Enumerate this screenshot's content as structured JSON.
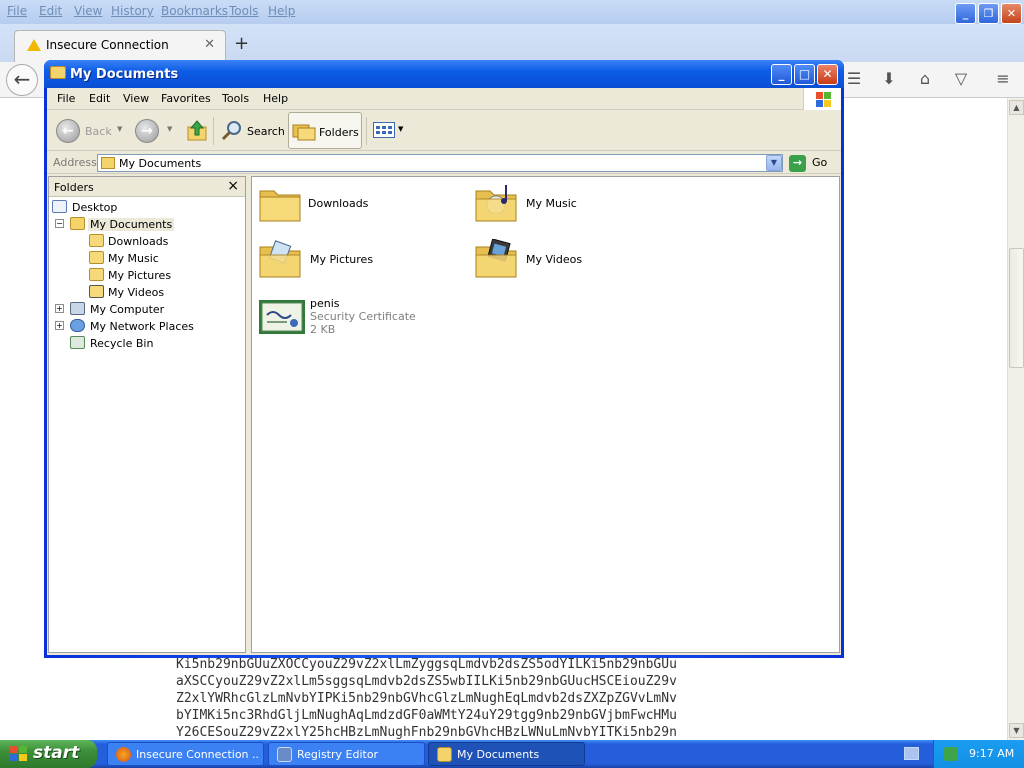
{
  "firefox": {
    "menu": [
      "File",
      "Edit",
      "View",
      "History",
      "Bookmarks",
      "Tools",
      "Help"
    ],
    "tab_title": "Insecure Connection",
    "new_tab": "+",
    "page_text_lines": [
      "Ki5nb29nbGUuZXOCCyouZ29vZ2xlLmZyggsqLmdvb2dsZS5odYILKi5nb29nbGUu",
      "aXSCCyouZ29vZ2xlLm5sggsqLmdvb2dsZS5wbIILKi5nb29nbGUucHSCEiouZ29v",
      "Z2xlYWRhcGlzLmNvbYIPKi5nb29nbGVhcGlzLmNughEqLmdvb2dsZXZpZGVvLmNv",
      "bYIMKi5nc3RhdGljLmNughAqLmdzdGF0aWMtY24uY29tgg9nb29nbGVjbmFwcHMu",
      "Y26CESouZ29vZ2xlY25hcHBzLmNughFnb29nbGVhcHBzLWNuLmNvbYITKi5nb29n"
    ]
  },
  "explorer": {
    "title": "My Documents",
    "menu": [
      "File",
      "Edit",
      "View",
      "Favorites",
      "Tools",
      "Help"
    ],
    "toolbar": {
      "back": "Back",
      "search": "Search",
      "folders": "Folders"
    },
    "address": {
      "label": "Address",
      "value": "My Documents",
      "go": "Go"
    },
    "tree": {
      "header": "Folders",
      "close": "×",
      "nodes": [
        {
          "label": "Desktop"
        },
        {
          "label": "My Documents",
          "expander": "−"
        },
        {
          "label": "Downloads"
        },
        {
          "label": "My Music"
        },
        {
          "label": "My Pictures"
        },
        {
          "label": "My Videos"
        },
        {
          "label": "My Computer",
          "expander": "+"
        },
        {
          "label": "My Network Places",
          "expander": "+"
        },
        {
          "label": "Recycle Bin"
        }
      ]
    },
    "items": [
      {
        "name": "Downloads"
      },
      {
        "name": "My Music"
      },
      {
        "name": "My Pictures"
      },
      {
        "name": "My Videos"
      },
      {
        "name": "penis",
        "type": "Security Certificate",
        "size": "2 KB"
      }
    ]
  },
  "taskbar": {
    "start": "start",
    "tasks": [
      "Insecure Connection ...",
      "Registry Editor",
      "My Documents"
    ],
    "clock": "9:17 AM"
  },
  "colors": {
    "xp_blue": "#0a4fd4",
    "taskbar": "#245edb",
    "start_green": "#3c8f3a",
    "tray": "#1190e4"
  }
}
